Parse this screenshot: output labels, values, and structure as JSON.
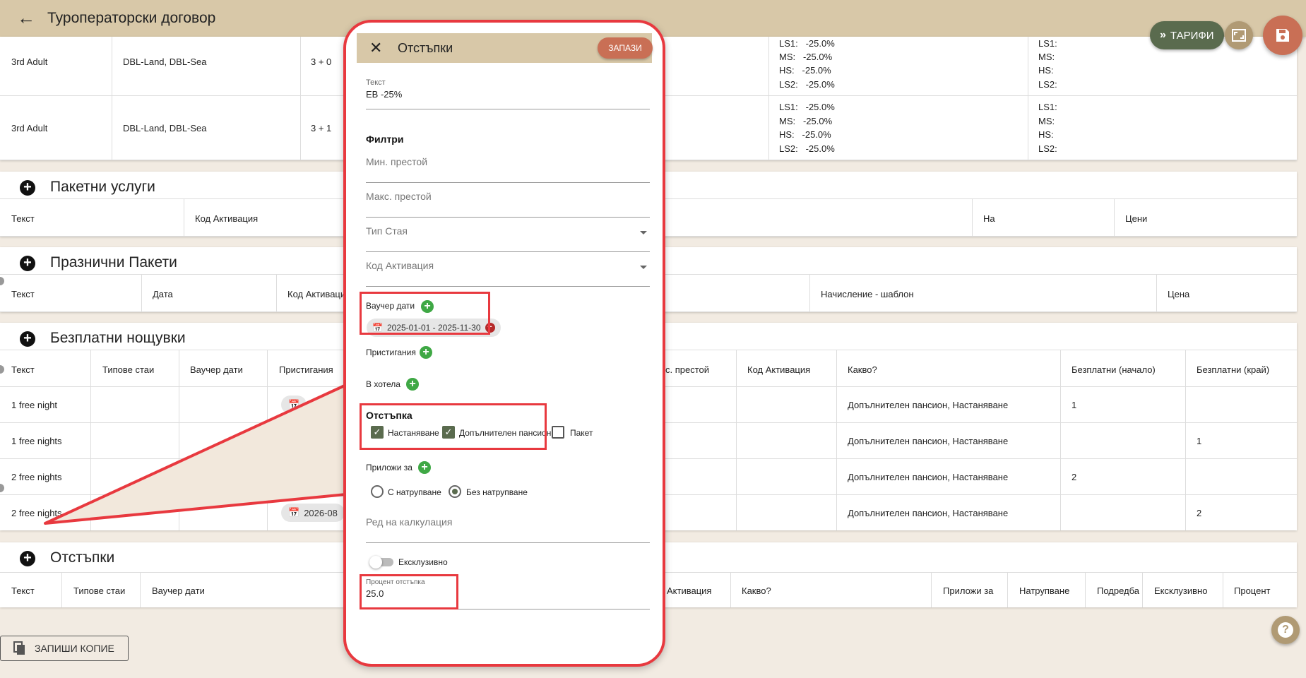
{
  "page": {
    "title": "Туроператорски договор",
    "tariffs_label": "ТАРИФИ",
    "copy_button_label": "ЗАПИШИ КОПИЕ"
  },
  "adult_rows": [
    {
      "type": "3rd Adult",
      "rooms": "DBL-Land, DBL-Sea",
      "combo": "3 + 0",
      "discounts": [
        "LS1:   -25.0%",
        "MS:   -25.0%",
        "HS:   -25.0%",
        "LS2:   -25.0%"
      ],
      "extra": [
        "LS1:",
        "MS:",
        "HS:",
        "LS2:"
      ]
    },
    {
      "type": "3rd Adult",
      "rooms": "DBL-Land, DBL-Sea",
      "combo": "3 + 1",
      "discounts": [
        "LS1:   -25.0%",
        "MS:   -25.0%",
        "HS:   -25.0%",
        "LS2:   -25.0%"
      ],
      "extra": [
        "LS1:",
        "MS:",
        "HS:",
        "LS2:"
      ]
    }
  ],
  "package_services": {
    "title": "Пакетни услуги",
    "headers": [
      "Текст",
      "Код Активация",
      "На",
      "Цени"
    ]
  },
  "holiday_packages": {
    "title": "Празнични Пакети",
    "headers": [
      "Текст",
      "Дата",
      "Код Активаци",
      "Начисление - шаблон",
      "Цена"
    ]
  },
  "free_nights": {
    "title": "Безплатни нощувки",
    "headers": [
      "Текст",
      "Типове стаи",
      "Ваучер дати",
      "Пристигания",
      "с. престой",
      "Код Активация",
      "Какво?",
      "Безплатни (начало)",
      "Безплатни (край)"
    ],
    "rows": [
      {
        "text": "1 free night",
        "what": "Допълнителен пансион, Настаняване",
        "start": "1",
        "end": "",
        "chip": ""
      },
      {
        "text": "1 free nights",
        "what": "Допълнителен пансион, Настаняване",
        "start": "",
        "end": "1",
        "chip": ""
      },
      {
        "text": "2 free nights",
        "what": "Допълнителен пансион, Настаняване",
        "start": "2",
        "end": "",
        "chip": ""
      },
      {
        "text": "2 free nights",
        "what": "Допълнителен пансион, Настаняване",
        "start": "",
        "end": "2",
        "chip": "2026-08"
      }
    ]
  },
  "discounts_section": {
    "title": "Отстъпки",
    "headers": [
      "Текст",
      "Типове стаи",
      "Ваучер дати",
      "Активация",
      "Какво?",
      "Приложи за",
      "Натрупване",
      "Подредба",
      "Ексклузивно",
      "Процент"
    ]
  },
  "modal": {
    "title": "Отстъпки",
    "save_label": "ЗАПАЗИ",
    "text_label": "Текст",
    "text_value": "EB -25%",
    "filters_label": "Филтри",
    "min_stay_placeholder": "Мин. престой",
    "max_stay_placeholder": "Макс. престой",
    "room_type_placeholder": "Тип Стая",
    "activation_code_placeholder": "Код Активация",
    "voucher_dates_label": "Ваучер дати",
    "voucher_chip": "2025-01-01 - 2025-11-30",
    "arrivals_label": "Пристигания",
    "in_hotel_label": "В хотела",
    "discount_label": "Отстъпка",
    "checkbox_accommodation": "Настаняване",
    "checkbox_extra_board": "Допълнителен пансион",
    "checkbox_package": "Пакет",
    "accommodation_checked": true,
    "extra_board_checked": true,
    "package_checked": false,
    "apply_for_label": "Приложи за",
    "radio_cumulative": "С натрупване",
    "radio_non_cumulative": "Без натрупване",
    "selected_radio": "Без натрупване",
    "calc_order_placeholder": "Ред на калкулация",
    "exclusive_label": "Ексклузивно",
    "exclusive_on": false,
    "percent_label": "Процент отстъпка",
    "percent_value": "25.0"
  },
  "colors": {
    "topbar": "#d8c8a8",
    "tariffs_button": "#5a6b4e",
    "save_fab": "#c96f55",
    "highlight": "#e8393f",
    "add_green": "#3fa845",
    "background": "#f2ebe2"
  },
  "icons": [
    "back-arrow-icon",
    "double-chevron-icon",
    "expand-icon",
    "save-disk-icon",
    "plus-circle-icon",
    "close-icon",
    "calendar-icon",
    "remove-circle-icon",
    "copy-icon",
    "help-icon"
  ]
}
